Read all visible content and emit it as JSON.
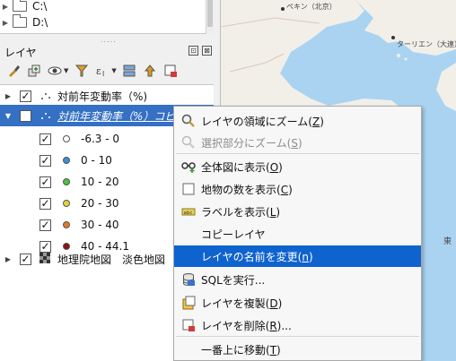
{
  "browser": {
    "items": [
      {
        "label": "C:\\"
      },
      {
        "label": "D:\\"
      }
    ]
  },
  "layers_panel": {
    "title": "レイヤ",
    "float_button": "⊡",
    "close_button": "⊠"
  },
  "layers": {
    "layer1": {
      "label": "対前年変動率（%)",
      "checked": true
    },
    "layer2": {
      "label": "対前年変動率（%）コピー"
    },
    "legend": [
      {
        "label": "-6.3 - 0",
        "color": "#ffffff"
      },
      {
        "label": "0 - 10",
        "color": "#3b8fd8"
      },
      {
        "label": "10 - 20",
        "color": "#4fc43d"
      },
      {
        "label": "20 - 30",
        "color": "#e4d735"
      },
      {
        "label": "30 - 40",
        "color": "#e5772a"
      },
      {
        "label": "40 - 44.1",
        "color": "#8c1212"
      }
    ],
    "basemap": {
      "label": "地理院地図　淡色地図"
    }
  },
  "context_menu": {
    "items": [
      {
        "label": "レイヤの領域にズーム",
        "shortcut": "Z"
      },
      {
        "label": "選択部分にズーム",
        "shortcut": "S"
      },
      {
        "label": "全体図に表示",
        "shortcut": "O"
      },
      {
        "label": "地物の数を表示",
        "shortcut": "C"
      },
      {
        "label": "ラベルを表示",
        "shortcut": "L"
      },
      {
        "label": "コピーレイヤ"
      },
      {
        "label": "レイヤの名前を変更",
        "shortcut": "n"
      },
      {
        "label": "SQLを実行..."
      },
      {
        "label": "レイヤを複製",
        "shortcut": "D"
      },
      {
        "label": "レイヤを削除",
        "shortcut": "R",
        "suffix": "..."
      },
      {
        "label": "一番上に移動",
        "shortcut": "T"
      }
    ]
  },
  "map": {
    "labels": [
      {
        "text": "ペキン（北京）"
      },
      {
        "text": "ターリエン（大連）"
      },
      {
        "text": "東"
      }
    ]
  },
  "colors": {
    "sea": "#aad3f2",
    "land": "#f2efe9",
    "selection": "#3470c4",
    "menu_highlight": "#0e63cf"
  }
}
